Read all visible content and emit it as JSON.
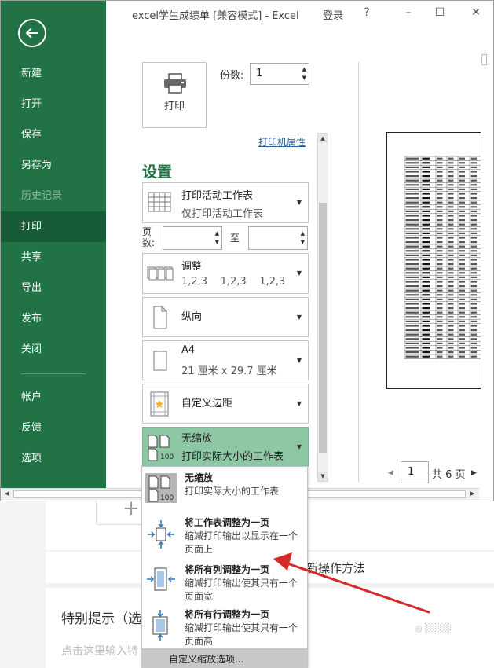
{
  "window": {
    "title": "excel学生成绩单 [兼容模式] - Excel",
    "login": "登录",
    "help": "?",
    "minimize": "–",
    "restore": "☐",
    "close": "✕"
  },
  "sidebar": {
    "items": [
      {
        "label": "新建"
      },
      {
        "label": "打开"
      },
      {
        "label": "保存"
      },
      {
        "label": "另存为"
      },
      {
        "label": "历史记录"
      },
      {
        "label": "打印"
      },
      {
        "label": "共享"
      },
      {
        "label": "导出"
      },
      {
        "label": "发布"
      },
      {
        "label": "关闭"
      },
      {
        "label": "帐户"
      },
      {
        "label": "反馈"
      },
      {
        "label": "选项"
      }
    ],
    "active": "打印",
    "bg_color": "#217346"
  },
  "print": {
    "button_label": "打印",
    "copies_label": "份数:",
    "copies_value": "1",
    "printer_properties": "打印机属性",
    "settings_heading": "设置"
  },
  "settings": {
    "print_what": {
      "title": "打印活动工作表",
      "subtitle": "仅打印活动工作表"
    },
    "pages_label": "页数:",
    "pages_to": "至",
    "collate": {
      "title": "调整",
      "subtitle": "1,2,3    1,2,3    1,2,3"
    },
    "orientation": {
      "title": "纵向"
    },
    "paper": {
      "title": "A4",
      "subtitle": "21 厘米 x 29.7 厘米"
    },
    "margins": {
      "title": "自定义边距"
    },
    "scaling": {
      "title": "无缩放",
      "subtitle": "打印实际大小的工作表"
    }
  },
  "preview": {
    "page_current": "1",
    "page_total": "共 6 页"
  },
  "scaling_menu": {
    "items": [
      {
        "title": "无缩放",
        "desc": "打印实际大小的工作表"
      },
      {
        "title": "将工作表调整为一页",
        "desc": "缩减打印输出以显示在一个页面上"
      },
      {
        "title": "将所有列调整为一页",
        "desc": "缩减打印输出使其只有一个页面宽"
      },
      {
        "title": "将所有行调整为一页",
        "desc": "缩减打印输出使其只有一个页面高"
      }
    ],
    "footer": "自定义缩放选项..."
  },
  "underlay": {
    "add_symbol": "+",
    "heading_partial": "新操作方法",
    "tip_title": "特别提示（选",
    "tip_placeholder": "点击这里输入特"
  }
}
